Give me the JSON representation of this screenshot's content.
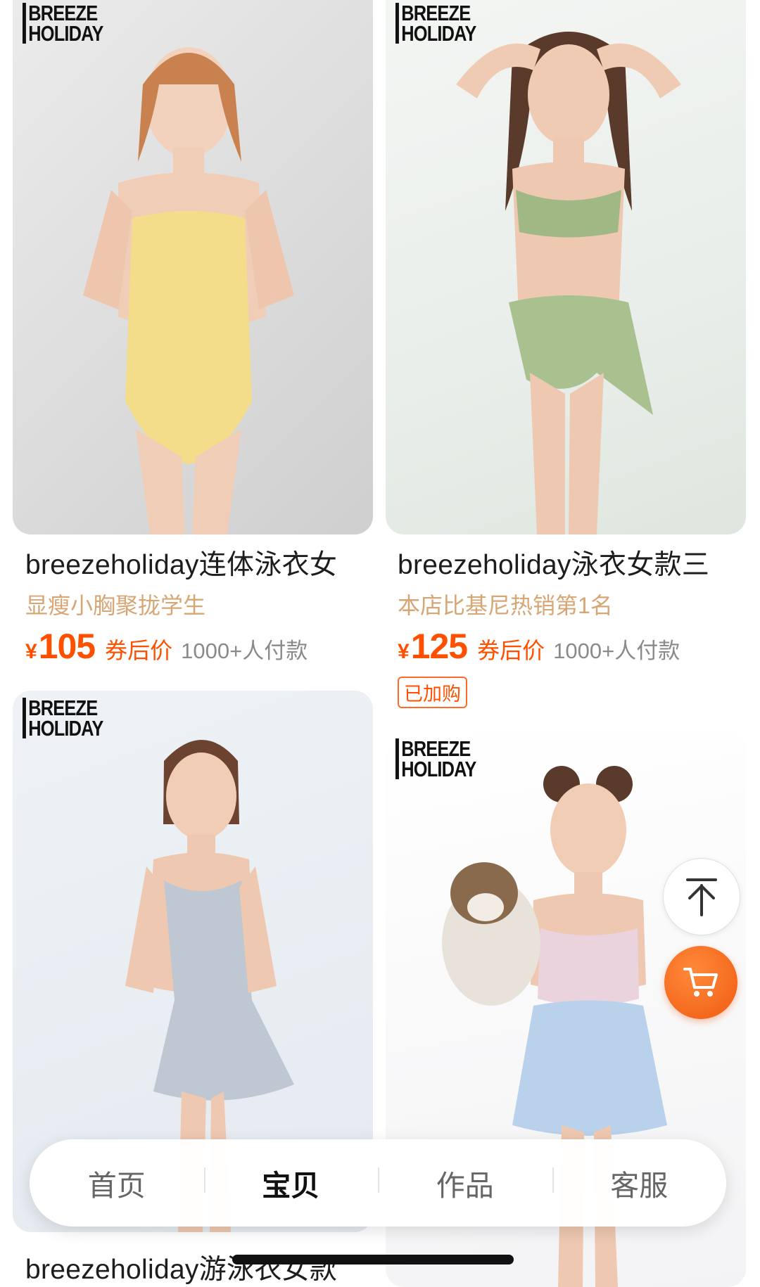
{
  "brand_logo": {
    "line1": "BREEZE",
    "line2": "HOLIDAY"
  },
  "products": [
    {
      "title": "breezeholiday连体泳衣女",
      "subtitle": "显瘦小胸聚拢学生",
      "currency": "¥",
      "price": "105",
      "price_note": "券后价",
      "sold": "1000+人付款"
    },
    {
      "title": "breezeholiday泳衣女款三",
      "subtitle": "本店比基尼热销第1名",
      "currency": "¥",
      "price": "125",
      "price_note": "券后价",
      "sold": "1000+人付款",
      "badge": "已加购"
    },
    {
      "title": "breezeholiday游泳衣女款"
    }
  ],
  "floating": {
    "top_icon": "arrow-up-to-top-icon",
    "cart_icon": "cart-icon"
  },
  "tabbar": {
    "tabs": [
      "首页",
      "宝贝",
      "作品",
      "客服"
    ],
    "active": "宝贝"
  },
  "colors": {
    "price": "#ff5000",
    "subtitle": "#d7a675",
    "cart_button": "#f26a1b"
  }
}
